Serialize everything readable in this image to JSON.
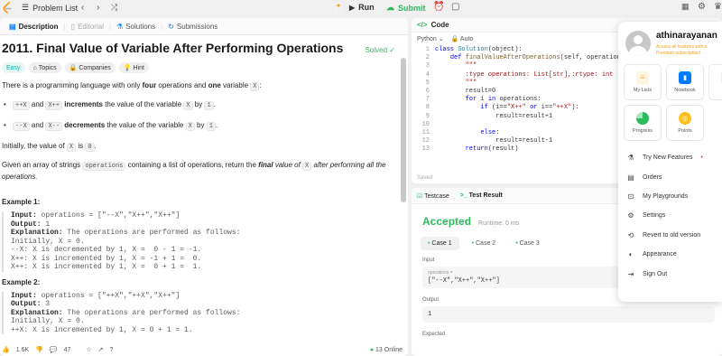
{
  "topbar": {
    "problem_list": "Problem List",
    "run": "Run",
    "submit": "Submit"
  },
  "left": {
    "tabs": [
      "Description",
      "Editorial",
      "Solutions",
      "Submissions"
    ],
    "title": "2011. Final Value of Variable After Performing Operations",
    "solved": "Solved",
    "badges": [
      "Easy",
      "Topics",
      "Companies",
      "Hint"
    ],
    "p1": {
      "a": "There is a programming language with only ",
      "b": "four",
      "c": " operations and ",
      "d": "one",
      "e": " variable ",
      "f": "X",
      "g": ":"
    },
    "b1": {
      "code1": "++X",
      "and": " and ",
      "code2": "X++",
      "bold": " increments",
      "rest": " the value of the variable ",
      "code3": "X",
      "by": " by ",
      "code4": "1",
      "end": "."
    },
    "b2": {
      "code1": "--X",
      "and": " and ",
      "code2": "X--",
      "bold": " decrements",
      "rest": " the value of the variable ",
      "code3": "X",
      "by": " by ",
      "code4": "1",
      "end": "."
    },
    "p2": {
      "a": "Initially, the value of ",
      "code1": "X",
      "b": " is ",
      "code2": "0",
      "c": "."
    },
    "p3": {
      "a": "Given an array of strings ",
      "code1": "operations",
      "b": " containing a list of operations, return the ",
      "c": "final",
      "d": " value of ",
      "code2": "X",
      "e": " after performing all the operations."
    },
    "ex1_title": "Example 1:",
    "ex1": {
      "input_label": "Input:",
      "input": " operations = [\"--X\",\"X++\",\"X++\"]",
      "output_label": "Output:",
      "output": " 1",
      "expl_label": "Explanation:",
      "expl": " The operations are performed as follows:",
      "l1": "Initially, X = 0.",
      "l2": "--X: X is decremented by 1, X =  0 - 1 = -1.",
      "l3": "X++: X is incremented by 1, X = -1 + 1 =  0.",
      "l4": "X++: X is incremented by 1, X =  0 + 1 =  1."
    },
    "ex2_title": "Example 2:",
    "ex2": {
      "input_label": "Input:",
      "input": " operations = [\"++X\",\"++X\",\"X++\"]",
      "output_label": "Output:",
      "output": " 3",
      "expl_label": "Explanation:",
      "expl": " The operations are performed as follows:",
      "l1": "Initially, X = 0.",
      "l2": "++X: X is incremented by 1, X = 0 + 1 = 1."
    },
    "footer": {
      "likes": "1.6K",
      "comments": "47",
      "online": "13 Online"
    }
  },
  "code": {
    "title": "Code",
    "lang": "Python",
    "auto": "Auto",
    "saved": "Saved"
  },
  "result": {
    "testcase": "Testcase",
    "test_result": "Test Result",
    "accepted": "Accepted",
    "runtime": "Runtime: 0 ms",
    "cases": [
      "Case 1",
      "Case 2",
      "Case 3"
    ],
    "input_label": "Input",
    "input_var": "operations =",
    "input_val": "[\"--X\",\"X++\",\"X++\"]",
    "output_label": "Output",
    "output_val": "1",
    "expected_label": "Expected"
  },
  "menu": {
    "username": "athinarayanan",
    "premium1": "Access all features with o",
    "premium2": "Premium subscription!",
    "tiles": [
      "My Lists",
      "Notebook",
      "Su",
      "Progress",
      "Points"
    ],
    "items": [
      "Try New Features",
      "Orders",
      "My Playgrounds",
      "Settings",
      "Revert to old version",
      "Appearance",
      "Sign Out"
    ]
  },
  "colors": {
    "accent_green": "#2cbb5d",
    "orange": "#ffa116",
    "blue": "#007bff"
  }
}
